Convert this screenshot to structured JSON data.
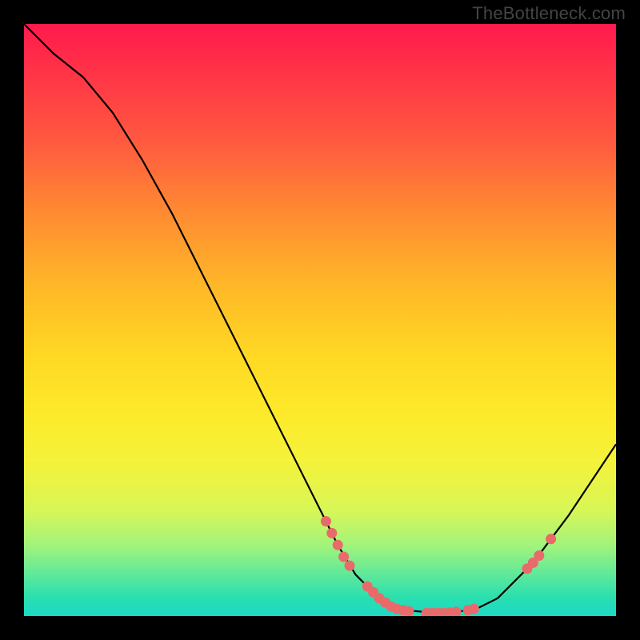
{
  "watermark": "TheBottleneck.com",
  "chart_data": {
    "type": "line",
    "title": "",
    "xlabel": "",
    "ylabel": "",
    "xlim": [
      0,
      100
    ],
    "ylim": [
      0,
      100
    ],
    "curve": [
      {
        "x": 0,
        "y": 100
      },
      {
        "x": 5,
        "y": 95
      },
      {
        "x": 10,
        "y": 91
      },
      {
        "x": 15,
        "y": 85
      },
      {
        "x": 20,
        "y": 77
      },
      {
        "x": 25,
        "y": 68
      },
      {
        "x": 30,
        "y": 58
      },
      {
        "x": 35,
        "y": 48
      },
      {
        "x": 40,
        "y": 38
      },
      {
        "x": 45,
        "y": 28
      },
      {
        "x": 50,
        "y": 18
      },
      {
        "x": 53,
        "y": 12
      },
      {
        "x": 56,
        "y": 7
      },
      {
        "x": 60,
        "y": 3
      },
      {
        "x": 64,
        "y": 1
      },
      {
        "x": 70,
        "y": 0.5
      },
      {
        "x": 76,
        "y": 1
      },
      {
        "x": 80,
        "y": 3
      },
      {
        "x": 86,
        "y": 9
      },
      {
        "x": 92,
        "y": 17
      },
      {
        "x": 100,
        "y": 29
      }
    ],
    "markers": [
      {
        "x": 51,
        "y": 16
      },
      {
        "x": 52,
        "y": 14
      },
      {
        "x": 53,
        "y": 12
      },
      {
        "x": 54,
        "y": 10
      },
      {
        "x": 55,
        "y": 8.5
      },
      {
        "x": 58,
        "y": 5
      },
      {
        "x": 59,
        "y": 4
      },
      {
        "x": 60,
        "y": 3
      },
      {
        "x": 61,
        "y": 2.3
      },
      {
        "x": 62,
        "y": 1.6
      },
      {
        "x": 63,
        "y": 1.2
      },
      {
        "x": 64,
        "y": 1
      },
      {
        "x": 65,
        "y": 0.8
      },
      {
        "x": 68,
        "y": 0.5
      },
      {
        "x": 69,
        "y": 0.5
      },
      {
        "x": 70,
        "y": 0.5
      },
      {
        "x": 71,
        "y": 0.5
      },
      {
        "x": 72,
        "y": 0.6
      },
      {
        "x": 73,
        "y": 0.7
      },
      {
        "x": 75,
        "y": 1
      },
      {
        "x": 76,
        "y": 1.2
      },
      {
        "x": 85,
        "y": 8
      },
      {
        "x": 86,
        "y": 9
      },
      {
        "x": 87,
        "y": 10.2
      },
      {
        "x": 89,
        "y": 13
      }
    ],
    "marker_color": "#e86a6a",
    "line_color": "#000000"
  }
}
